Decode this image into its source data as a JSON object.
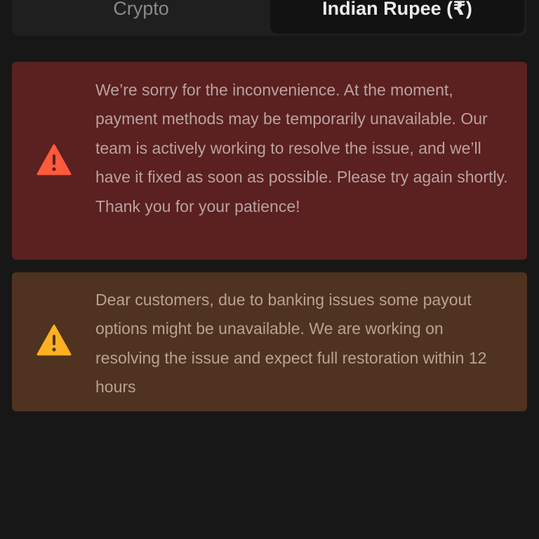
{
  "tabs": {
    "crypto_label": "Crypto",
    "inr_label": "Indian Rupee (₹)"
  },
  "alerts": {
    "error": {
      "icon": "warning-triangle-icon",
      "color": "#ff5a3c",
      "message": "We’re sorry for the inconvenience. At the moment, payment methods may be temporarily unavailable. Our team is actively working to resolve the issue, and we’ll have it fixed as soon as possible. Please try again shortly. Thank you for your patience!"
    },
    "warning": {
      "icon": "warning-triangle-icon",
      "color": "#ffb020",
      "message": "Dear customers, due to banking issues some payout options might be unavailable. We are working on resolving the issue and expect full restoration within 12 hours"
    }
  }
}
